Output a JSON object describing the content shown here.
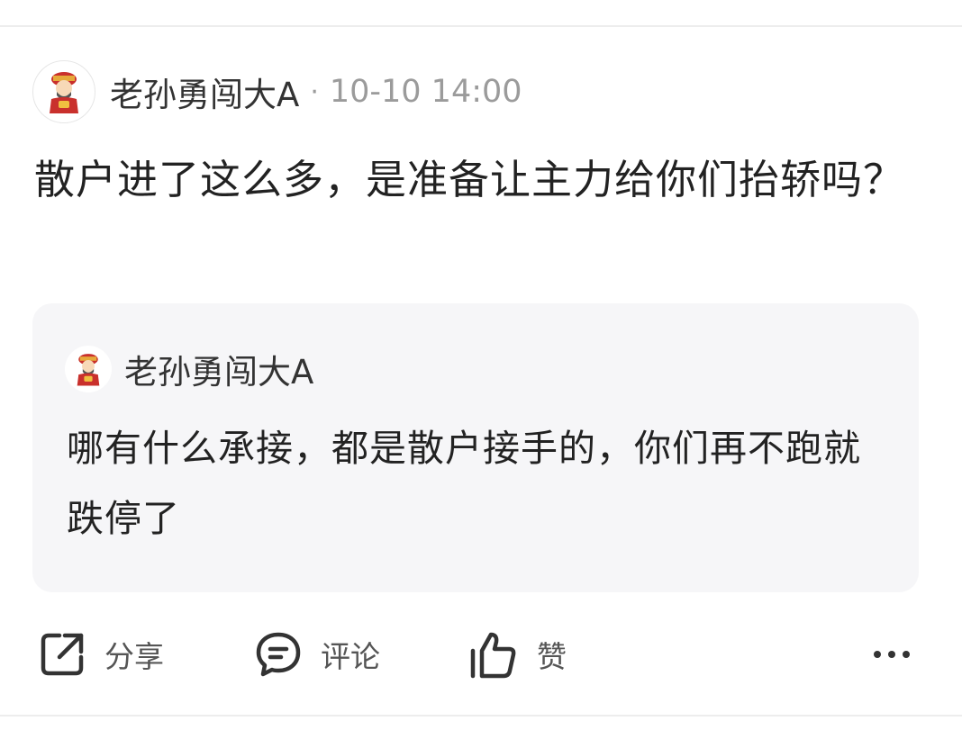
{
  "post": {
    "author": "老孙勇闯大A",
    "separator": "·",
    "time": "10-10 14:00",
    "content": "散户进了这么多，是准备让主力给你们抬轿吗？"
  },
  "quote": {
    "author": "老孙勇闯大A",
    "content": "哪有什么承接，都是散户接手的，你们再不跑就跌停了"
  },
  "actions": {
    "share": "分享",
    "comment": "评论",
    "like": "赞"
  },
  "icons": {
    "share": "share-icon",
    "comment": "comment-icon",
    "like": "thumbs-up-icon",
    "more": "more-icon",
    "avatar": "avatar-icon"
  },
  "colors": {
    "text": "#222222",
    "meta": "#9b9b9b",
    "quote_bg": "#f6f6f8"
  }
}
